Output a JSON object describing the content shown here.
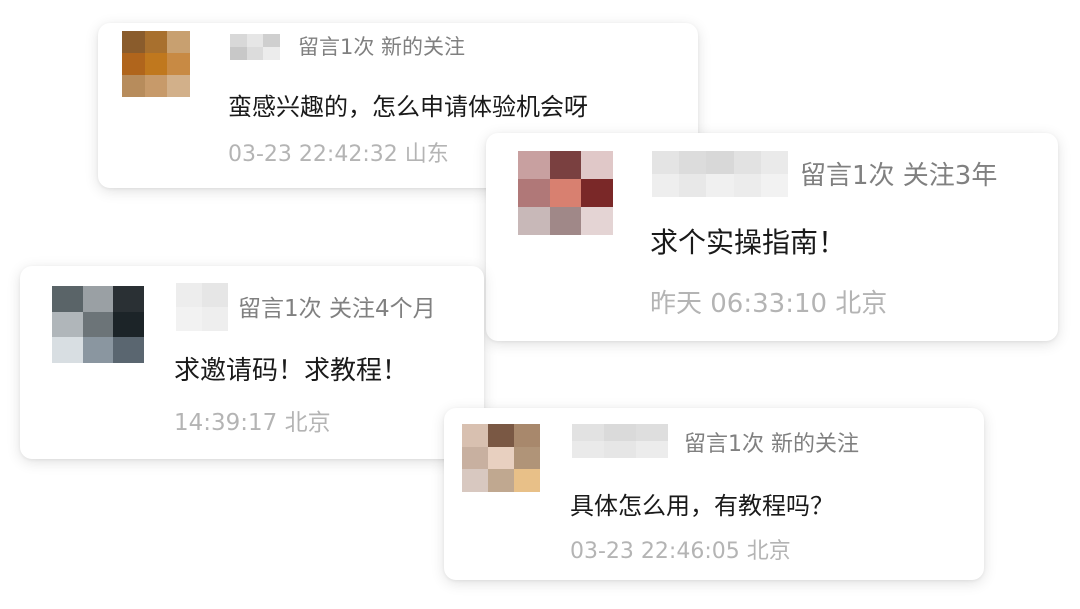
{
  "comments": [
    {
      "stats": "留言1次 新的关注",
      "message": "蛮感兴趣的，怎么申请体验机会呀",
      "time": "03-23 22:42:32 山东",
      "avatar_colors": [
        "#8a5c2c",
        "#a8702e",
        "#c8a070",
        "#b0651c",
        "#c0781e",
        "#c88a44",
        "#b78c5c",
        "#c79a6a",
        "#d2b08a"
      ],
      "name_colors": [
        "#d8d8d8",
        "#c8c8c8",
        "#e6e6e6",
        "#dcdcdc",
        "#cfcfcf",
        "#ececec"
      ]
    },
    {
      "stats": "留言1次 关注3年",
      "message": "求个实操指南！",
      "time": "昨天 06:33:10 北京",
      "avatar_colors": [
        "#c8a0a0",
        "#7a4040",
        "#e0c8c8",
        "#b07878",
        "#d88070",
        "#7a2828",
        "#c8b8b8",
        "#a08888",
        "#e4d4d4"
      ],
      "name_colors": [
        "#e4e4e4",
        "#eeeeee",
        "#dcdcdc",
        "#e8e8e8",
        "#d8d8d8",
        "#f0f0f0",
        "#e2e2e2",
        "#ececec",
        "#eaeaea",
        "#f2f2f2"
      ]
    },
    {
      "stats": "留言1次 关注4个月",
      "message": "求邀请码！求教程！",
      "time": "14:39:17 北京",
      "avatar_colors": [
        "#5a6468",
        "#9aa0a4",
        "#2a3034",
        "#b0b6ba",
        "#6c7478",
        "#1c2428",
        "#d8dee2",
        "#8a96a0",
        "#5a6670"
      ],
      "name_colors": [
        "#ededed",
        "#f2f2f2",
        "#e6e6e6",
        "#eeeeee"
      ]
    },
    {
      "stats": "留言1次 新的关注",
      "message": "具体怎么用，有教程吗？",
      "time": "03-23 22:46:05 北京",
      "avatar_colors": [
        "#d8c0b0",
        "#7a5844",
        "#a8886c",
        "#c8b0a0",
        "#e8d0c0",
        "#b09478",
        "#d8c8c0",
        "#c0a890",
        "#e8c088"
      ],
      "name_colors": [
        "#e2e2e2",
        "#eaeaea",
        "#dadada",
        "#e6e6e6",
        "#dedede",
        "#ececec"
      ]
    }
  ]
}
